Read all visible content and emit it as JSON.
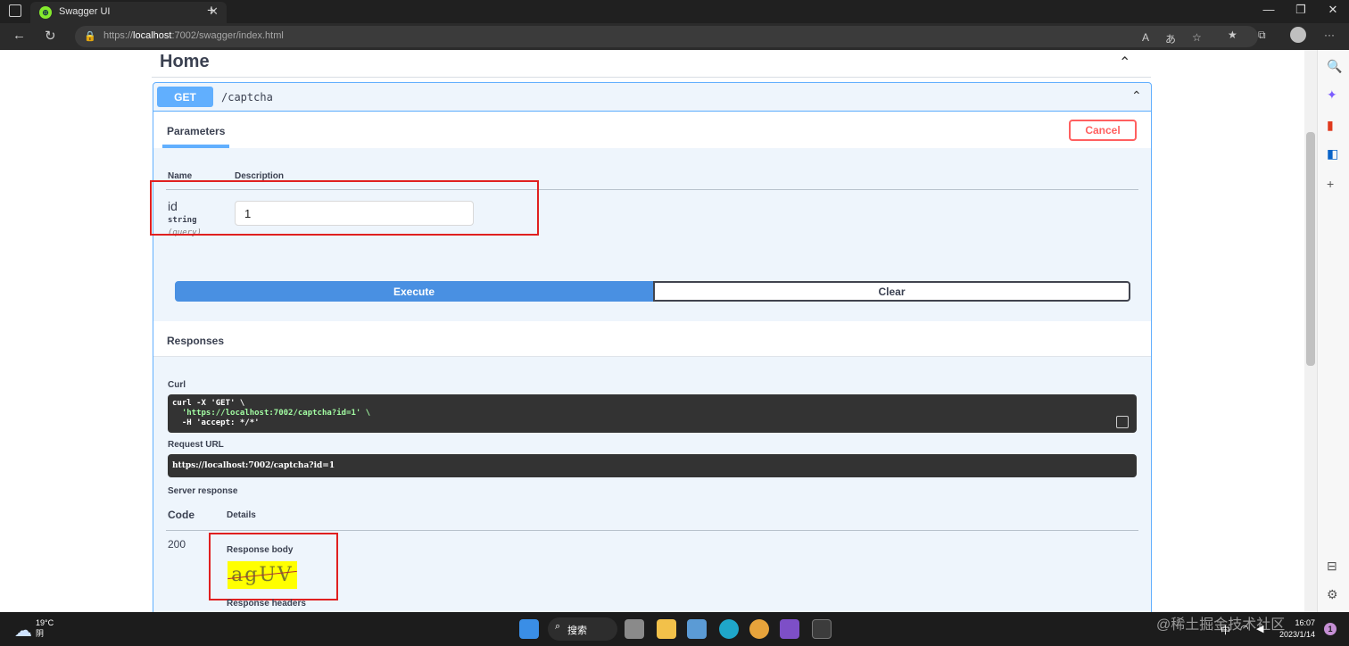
{
  "browser": {
    "tab_title": "Swagger UI",
    "url_prefix": "https://",
    "url_host": "localhost",
    "url_rest": ":7002/swagger/index.html"
  },
  "page": {
    "section_title": "Home",
    "operation": {
      "method": "GET",
      "path": "/captcha",
      "parameters_tab": "Parameters",
      "cancel_label": "Cancel",
      "col_name": "Name",
      "col_description": "Description",
      "param": {
        "name": "id",
        "type": "string",
        "location": "(query)",
        "value": "1"
      },
      "execute_label": "Execute",
      "clear_label": "Clear"
    },
    "responses": {
      "title": "Responses",
      "curl_label": "Curl",
      "curl_lines": [
        "curl -X 'GET' \\",
        "  'https://localhost:7002/captcha?id=1' \\",
        "  -H 'accept: */*'"
      ],
      "request_url_label": "Request URL",
      "request_url": "https://localhost:7002/captcha?id=1",
      "server_response_label": "Server response",
      "col_code": "Code",
      "col_details": "Details",
      "code": "200",
      "response_body_label": "Response body",
      "captcha_text": "agUV",
      "response_headers_label": "Response headers"
    }
  },
  "taskbar": {
    "temperature": "19°C",
    "weather_desc": "阴",
    "search_label": "搜索",
    "ime": "中",
    "time": "16:07",
    "date": "2023/1/14",
    "notification_count": "1",
    "watermark": "@稀土掘金技术社区"
  },
  "colors": {
    "get": "#61affe",
    "execute": "#4990e2",
    "cancel": "#ff6060",
    "highlight_box": "#e02020"
  }
}
